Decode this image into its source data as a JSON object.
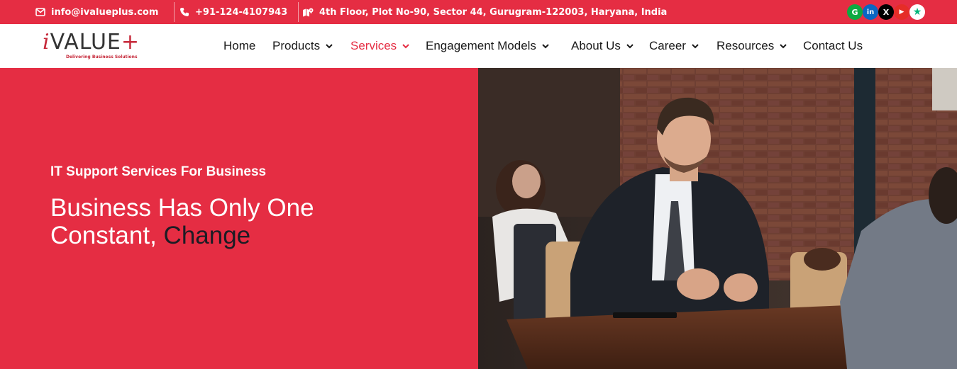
{
  "topbar": {
    "email": "info@ivalueplus.com",
    "phone": "+91-124-4107943",
    "address": "4th Floor, Plot No-90, Sector 44, Gurugram-122003, Haryana, India",
    "social": [
      {
        "name": "glassdoor",
        "glyph": "G",
        "color": "#0caa41"
      },
      {
        "name": "linkedin",
        "glyph": "in",
        "color": "#0a66c2"
      },
      {
        "name": "x",
        "glyph": "X",
        "color": "#000000"
      },
      {
        "name": "youtube",
        "glyph": "▶",
        "color": "#e52d27"
      },
      {
        "name": "trustpilot",
        "glyph": "★",
        "color": "#00b67a"
      }
    ]
  },
  "logo": {
    "prefix": "i",
    "text": "VALUE",
    "suffix": "+",
    "tagline": "Delivering Business Solutions"
  },
  "nav": {
    "items": [
      {
        "label": "Home",
        "dropdown": false
      },
      {
        "label": "Products",
        "dropdown": true
      },
      {
        "label": "Services",
        "dropdown": true,
        "active": true
      },
      {
        "label": "Engagement Models",
        "dropdown": true
      },
      {
        "label": "About Us",
        "dropdown": true
      },
      {
        "label": "Career",
        "dropdown": true
      },
      {
        "label": "Resources",
        "dropdown": true
      },
      {
        "label": "Contact Us",
        "dropdown": false
      }
    ]
  },
  "hero": {
    "subtitle": "IT Support Services For Business",
    "title_line1": "Business Has Only One",
    "title_line2_prefix": "Constant, ",
    "title_line2_highlight": "Change"
  },
  "colors": {
    "brand": "#e52d43",
    "dark_text": "#1c1c24"
  }
}
